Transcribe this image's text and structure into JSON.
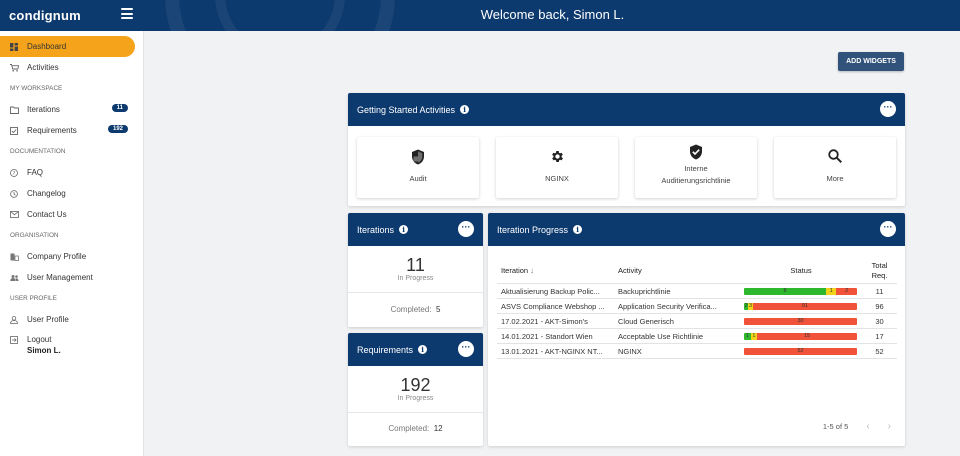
{
  "app": {
    "logo": "condignum",
    "welcome": "Welcome back, Simon L."
  },
  "sidebar": {
    "items": [
      {
        "label": "Dashboard",
        "icon": "dashboard-icon",
        "active": true
      },
      {
        "label": "Activities",
        "icon": "cart-icon"
      }
    ],
    "sections": [
      {
        "title": "MY WORKSPACE",
        "items": [
          {
            "label": "Iterations",
            "icon": "folder-icon",
            "badge": "11"
          },
          {
            "label": "Requirements",
            "icon": "checkbox-icon",
            "badge": "192"
          }
        ]
      },
      {
        "title": "DOCUMENTATION",
        "items": [
          {
            "label": "FAQ",
            "icon": "help-icon"
          },
          {
            "label": "Changelog",
            "icon": "history-icon"
          },
          {
            "label": "Contact Us",
            "icon": "mail-icon"
          }
        ]
      },
      {
        "title": "ORGANISATION",
        "items": [
          {
            "label": "Company Profile",
            "icon": "building-icon"
          },
          {
            "label": "User Management",
            "icon": "users-icon"
          }
        ]
      },
      {
        "title": "USER PROFILE",
        "items": [
          {
            "label": "User Profile",
            "icon": "user-icon"
          },
          {
            "label": "Logout",
            "sub": "Simon L.",
            "icon": "logout-icon"
          }
        ]
      }
    ]
  },
  "toolbar": {
    "add_widgets": "ADD WIDGETS"
  },
  "getting_started": {
    "title": "Getting Started Activities",
    "tiles": [
      {
        "label": "Audit",
        "icon": "shield-icon"
      },
      {
        "label": "NGINX",
        "icon": "gear-icon"
      },
      {
        "label": "Interne",
        "label2": "Auditierungsrichtlinie",
        "icon": "verified-icon"
      },
      {
        "label": "More",
        "icon": "search-icon"
      }
    ]
  },
  "iterations_card": {
    "title": "Iterations",
    "count": "11",
    "status": "In Progress",
    "completed_label": "Completed:",
    "completed": "5"
  },
  "requirements_card": {
    "title": "Requirements",
    "count": "192",
    "status": "In Progress",
    "completed_label": "Completed:",
    "completed": "12"
  },
  "iteration_progress": {
    "title": "Iteration Progress",
    "columns": {
      "iteration": "Iteration",
      "sort_icon": "arrow-down-icon",
      "activity": "Activity",
      "status": "Status",
      "total_1": "Total",
      "total_2": "Req."
    },
    "rows": [
      {
        "iteration": "Aktualisierung Backup Polic...",
        "activity": "Backuprichtlinie",
        "segments": [
          {
            "c": "g",
            "v": 8
          },
          {
            "c": "y",
            "v": 1
          },
          {
            "c": "r",
            "v": 2
          }
        ],
        "total": "11"
      },
      {
        "iteration": "ASVS Compliance Webshop ...",
        "activity": "Application Security Verifica...",
        "segments": [
          {
            "c": "g",
            "v": 2
          },
          {
            "c": "y",
            "v": 3
          },
          {
            "c": "r",
            "v": 91
          }
        ],
        "total": "96"
      },
      {
        "iteration": "17.02.2021 - AKT-Simon's",
        "activity": "Cloud Generisch",
        "segments": [
          {
            "c": "r",
            "v": 30
          }
        ],
        "total": "30"
      },
      {
        "iteration": "14.01.2021 - Standort Wien",
        "activity": "Acceptable Use Richtlinie",
        "segments": [
          {
            "c": "g",
            "v": 1
          },
          {
            "c": "y",
            "v": 1
          },
          {
            "c": "r",
            "v": 15
          }
        ],
        "total": "17"
      },
      {
        "iteration": "13.01.2021 - AKT-NGINX NT...",
        "activity": "NGINX",
        "segments": [
          {
            "c": "r",
            "v": 52
          }
        ],
        "total": "52"
      }
    ],
    "pager": "1-5 of 5"
  },
  "colors": {
    "primary": "#0d3a6e",
    "accent": "#f5a31a",
    "green": "#2eb82e",
    "yellow": "#f2d21b",
    "red": "#f0533a"
  }
}
